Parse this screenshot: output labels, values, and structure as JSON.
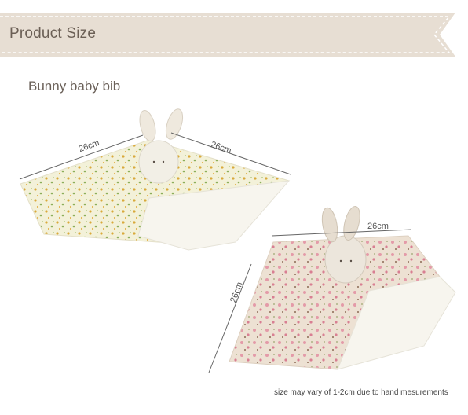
{
  "header": {
    "title": "Product Size"
  },
  "product": {
    "name": "Bunny baby bib"
  },
  "dimensions": {
    "bib1_left": "26cm",
    "bib1_right": "26cm",
    "bib2_top": "26cm",
    "bib2_left": "26cm"
  },
  "footer": {
    "note": "size may vary of 1-2cm due to hand mesurements"
  },
  "colors": {
    "banner": "#e7ded3",
    "banner_stitch": "#ffffff",
    "heading_text": "#6b5f55",
    "floral_green": "#f3f1d9",
    "floral_pink": "#ede1d3",
    "fleece": "#f7f5ee"
  }
}
